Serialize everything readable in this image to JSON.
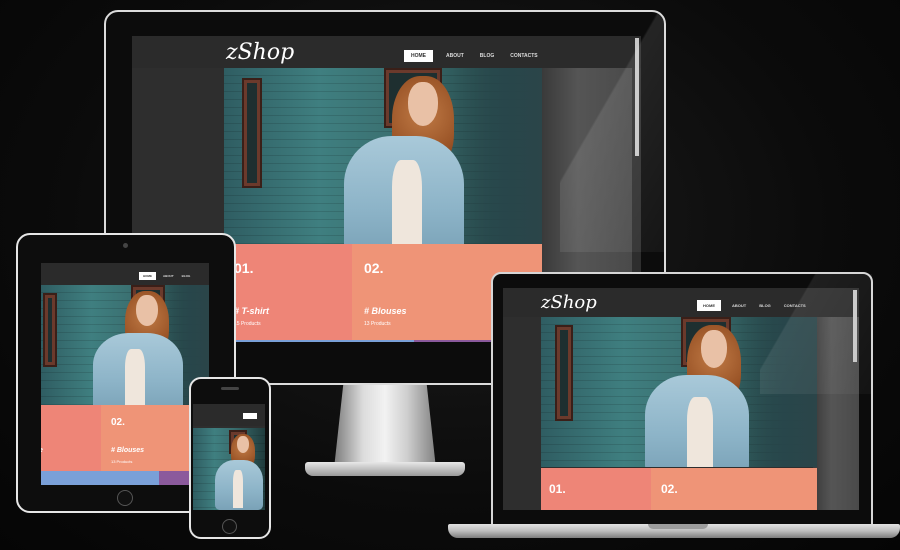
{
  "site": {
    "logo": "zShop",
    "menu": [
      "HOME",
      "ABOUT",
      "BLOG",
      "CONTACTS"
    ],
    "active_menu": "HOME"
  },
  "tiles": [
    {
      "number": "01.",
      "category": "# T-shirt",
      "count": "15 Products"
    },
    {
      "number": "02.",
      "category": "# Blouses",
      "count": "13 Products"
    }
  ],
  "colors": {
    "background": "#0b0b0b",
    "nav": "#2b2b2b",
    "tile_1": "#ee8577",
    "tile_2": "#ef9477",
    "bar_blue": "#7aa0d8",
    "bar_purple": "#8b5a9c"
  }
}
